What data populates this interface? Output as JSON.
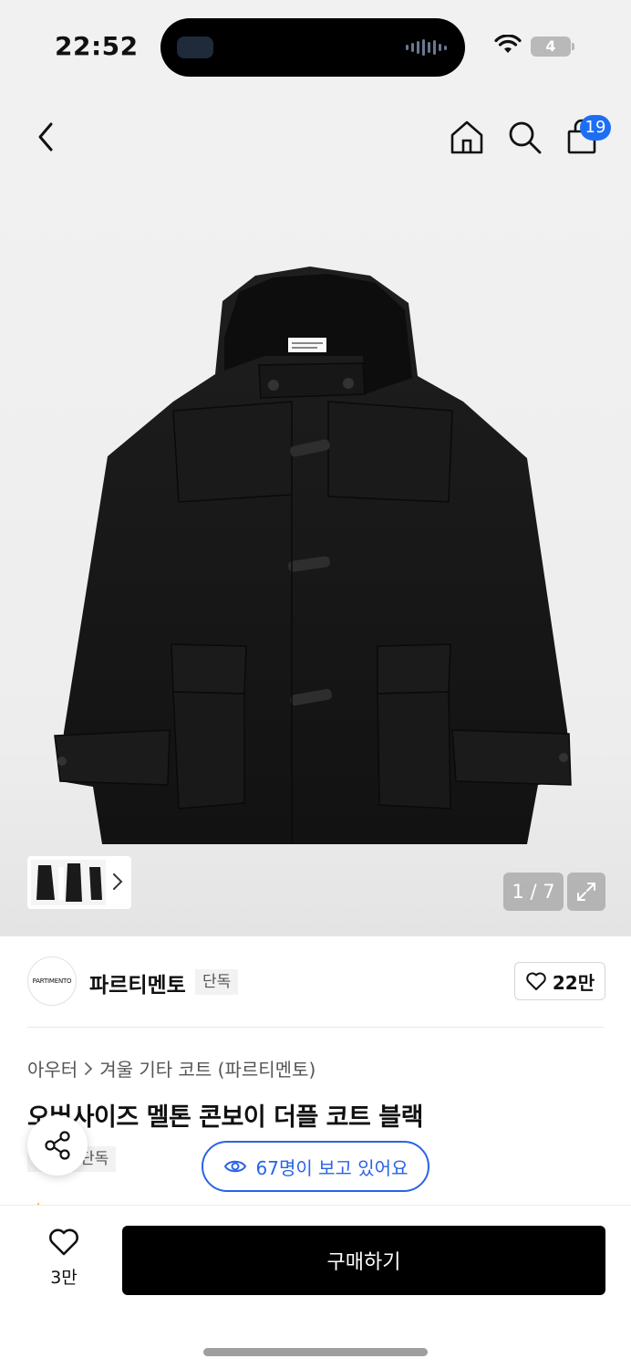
{
  "status_bar": {
    "time": "22:52",
    "battery": "4"
  },
  "nav": {
    "cart_count": "19"
  },
  "gallery": {
    "counter": "1 / 7"
  },
  "brand": {
    "logo_text": "PARTIMENTO",
    "name": "파르티멘토",
    "tag": "단독",
    "likes": "22만"
  },
  "breadcrumb": {
    "category": "아우터",
    "subcategory": "겨울 기타 코트 (파르티멘토)"
  },
  "product": {
    "title": "오버사이즈 멜톤 콘보이 더플 코트 블랙",
    "tag": "단독"
  },
  "viewers": {
    "text": "67명이 보고 있어요"
  },
  "bottom": {
    "wish_count": "3만",
    "buy_label": "구매하기"
  },
  "colors": {
    "accent": "#2a63e8",
    "badge": "#1d6ef5",
    "buy_bg": "#000000"
  }
}
